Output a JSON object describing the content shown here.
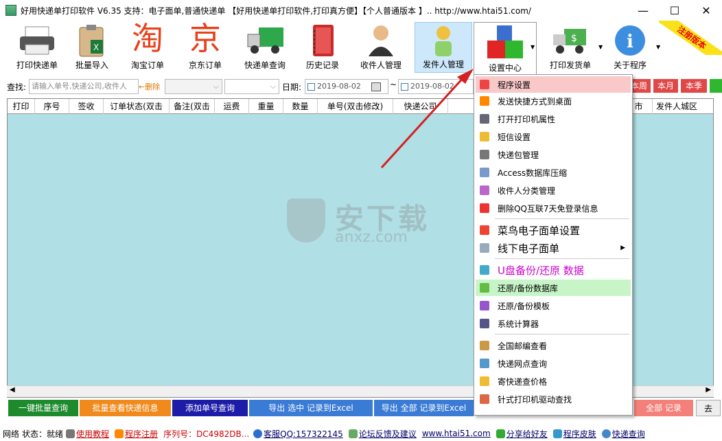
{
  "window": {
    "title": "好用快递单打印软件 V6.35  支持：电子面单,普通快递单 【好用快递单打印软件,打印真方便】【个人普通版本 】..   http://www.htai51.com/",
    "minimize": "—",
    "maximize": "☐",
    "close": "✕"
  },
  "toolbar": {
    "items": [
      {
        "label": "打印快递单"
      },
      {
        "label": "批量导入"
      },
      {
        "label": "淘宝订单",
        "glyph": "淘"
      },
      {
        "label": "京东订单",
        "glyph": "京"
      },
      {
        "label": "快递单查询"
      },
      {
        "label": "历史记录"
      },
      {
        "label": "收件人管理"
      },
      {
        "label": "发件人管理"
      },
      {
        "label": "设置中心"
      },
      {
        "label": "打印发货单"
      },
      {
        "label": "关于程序"
      }
    ],
    "ribbon": "注册版本"
  },
  "filter": {
    "search_label": "查找:",
    "search_placeholder": "请输入单号,快递公司,收件人",
    "delete_label": "←删除",
    "date_label": "日期:",
    "date_from": "2019-08-02",
    "date_to": "2019-08-02",
    "tilde": "~",
    "behind_menu": "设置中心",
    "period_buttons": [
      "本周",
      "本月",
      "本季"
    ]
  },
  "grid": {
    "columns": [
      "打印",
      "序号",
      "签收",
      "订单状态(双击",
      "备注(双击",
      "运费",
      "重量",
      "数量",
      "单号(双击修改)",
      "快递公司",
      "",
      "",
      "",
      "",
      "",
      "",
      "",
      "",
      "市",
      "发件人城区"
    ]
  },
  "watermark": {
    "title": "安下载",
    "subtitle": "anxz.com"
  },
  "bottom_buttons": [
    {
      "label": "一键批量查询",
      "color": "#1e8a2e"
    },
    {
      "label": "批量查看快递信息",
      "color": "#f08a1c"
    },
    {
      "label": "添加单号查询",
      "color": "#1c1ca8"
    },
    {
      "label": "导出 选中 记录到Excel",
      "color": "#3a7bd5"
    },
    {
      "label": "导出 全部 记录到Excel",
      "color": "#3a7bd5"
    },
    {
      "label": "全部 记录",
      "color": "#f4807a"
    },
    {
      "label": "去",
      "color": "#eeeeee"
    }
  ],
  "status": {
    "network": "网络",
    "state": "状态：就绪",
    "tutorial": "使用教程",
    "register": "程序注册",
    "serial": "序列号：DC4982DB...",
    "qq": "客服QQ:157322145",
    "forum": "论坛反馈及建议",
    "site": "www.htai51.com",
    "share": "分享给好友",
    "skin": "程序皮肤",
    "query": "快递查询"
  },
  "menu": {
    "items": [
      {
        "label": "程序设置",
        "icon": "settings-icon",
        "color": "#e44"
      },
      {
        "label": "发送快捷方式到桌面",
        "icon": "windows-icon",
        "color": "#f80"
      },
      {
        "label": "打开打印机属性",
        "icon": "printer-icon",
        "color": "#667"
      },
      {
        "label": "短信设置",
        "icon": "phone-icon",
        "color": "#eb3"
      },
      {
        "label": "快递包管理",
        "icon": "package-icon",
        "color": "#777"
      },
      {
        "label": "Access数据库压缩",
        "icon": "database-icon",
        "color": "#79c"
      },
      {
        "label": "收件人分类管理",
        "icon": "books-icon",
        "color": "#b6c"
      },
      {
        "label": "删除QQ互联7天免登录信息",
        "icon": "delete-icon",
        "color": "#e33"
      },
      {
        "label": "菜鸟电子面单设置",
        "icon": "cainiao-icon",
        "color": "#e43"
      },
      {
        "label": "线下电子面单",
        "icon": "offline-icon",
        "color": "#9ab"
      },
      {
        "label": "U盘备份/还原 数据",
        "icon": "usb-icon",
        "color": "#4ac"
      },
      {
        "label": "还原/备份数据库",
        "icon": "restore-db-icon",
        "color": "#6b4"
      },
      {
        "label": "还原/备份模板",
        "icon": "template-icon",
        "color": "#95c"
      },
      {
        "label": "系统计算器",
        "icon": "calculator-icon",
        "color": "#558"
      },
      {
        "label": "全国邮编查看",
        "icon": "postcode-icon",
        "color": "#c94"
      },
      {
        "label": "快递网点查询",
        "icon": "network-icon",
        "color": "#59c"
      },
      {
        "label": "寄快递查价格",
        "icon": "price-icon",
        "color": "#eb3"
      },
      {
        "label": "针式打印机驱动查找",
        "icon": "driver-icon",
        "color": "#d64"
      }
    ],
    "submenu_arrow": "▶"
  }
}
